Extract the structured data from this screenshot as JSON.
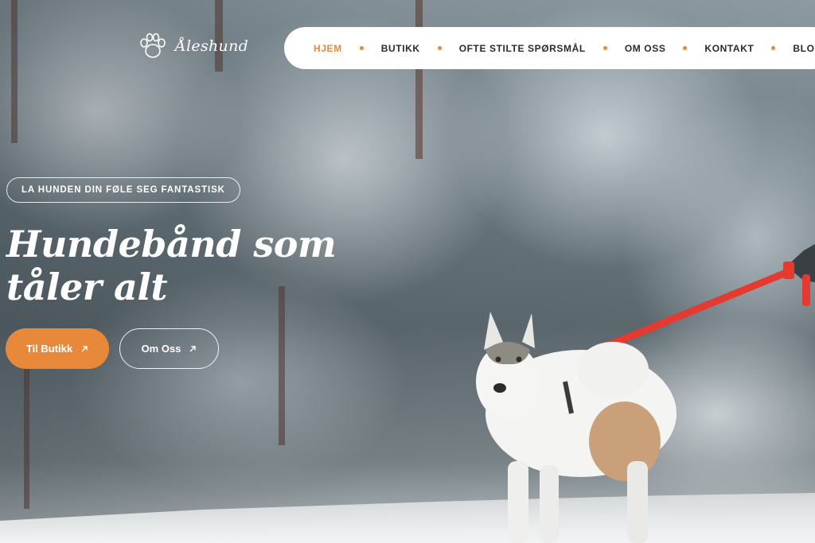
{
  "brand": {
    "name": "Åleshund",
    "icon": "paw-icon"
  },
  "nav": {
    "items": [
      {
        "label": "HJEM",
        "active": true
      },
      {
        "label": "BUTIKK",
        "active": false
      },
      {
        "label": "OFTE STILTE SPØRSMÅL",
        "active": false
      },
      {
        "label": "OM OSS",
        "active": false
      },
      {
        "label": "KONTAKT",
        "active": false
      },
      {
        "label": "BLOGG",
        "active": false
      }
    ]
  },
  "hero": {
    "tagline": "LA HUNDEN DIN FØLE SEG FANTASTISK",
    "headline_line1": "Hundebånd som",
    "headline_line2": "tåler alt",
    "primary_button": "Til Butikk",
    "secondary_button": "Om Oss",
    "button_icon": "arrow-up-right-icon"
  },
  "colors": {
    "accent": "#e8883b",
    "nav_bg": "#ffffff",
    "text_light": "#ffffff",
    "leash": "#e53a2f"
  }
}
